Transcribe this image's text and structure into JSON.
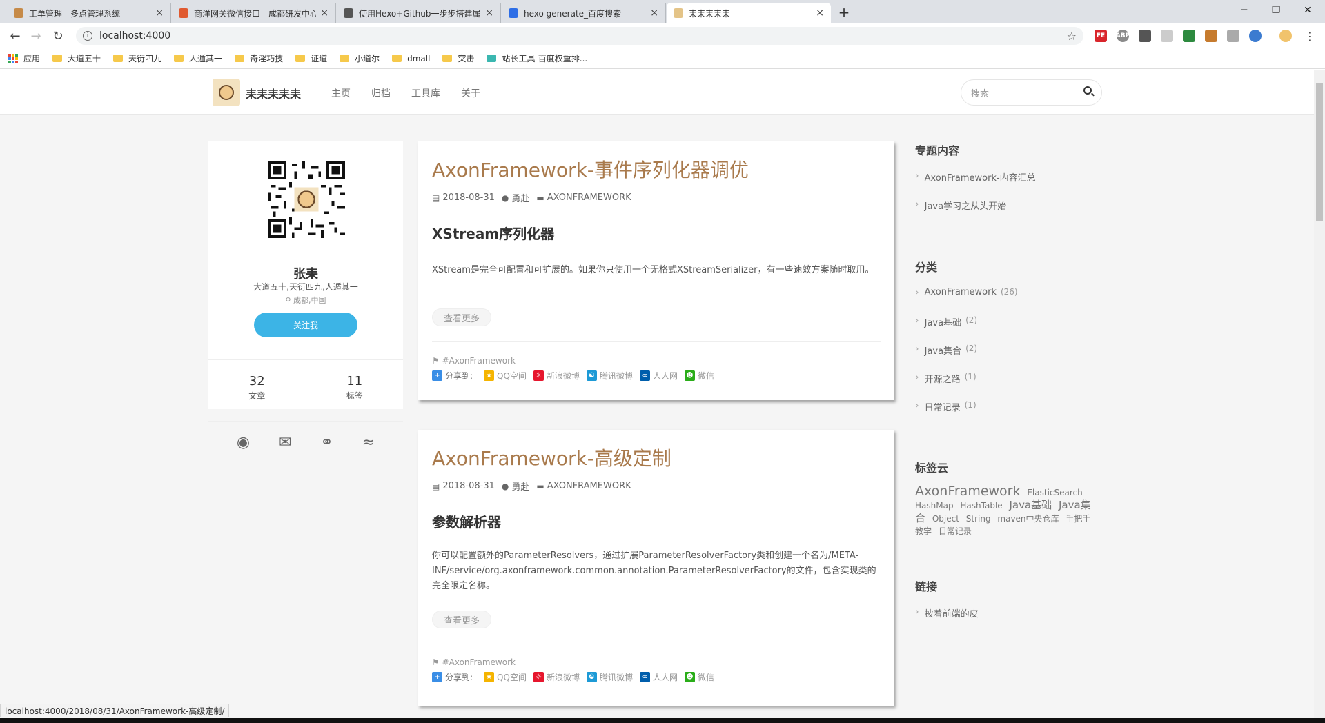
{
  "browser": {
    "tabs": [
      {
        "title": "工单管理 - 多点管理系统",
        "fav_color": "#c68a48"
      },
      {
        "title": "商洋网关微信接口 - 成都研发中心",
        "fav_color": "#e05a30"
      },
      {
        "title": "使用Hexo+Github一步步搭建属...",
        "fav_color": "#555555"
      },
      {
        "title": "hexo generate_百度搜索",
        "fav_color": "#2e6ee6"
      },
      {
        "title": "耒耒耒耒耒",
        "fav_color": "#e4c488"
      }
    ],
    "close_glyph": "×",
    "newtab_glyph": "+",
    "window": {
      "minimize": "─",
      "maximize": "❐",
      "close": "✕"
    },
    "url": "localhost:4000",
    "bookmarks": [
      "应用",
      "大道五十",
      "天衍四九",
      "人遁其一",
      "奇淫巧技",
      "证道",
      "小道尔",
      "dmall",
      "突击",
      "站长工具-百度权重排..."
    ],
    "extensions": [
      "FE",
      "ABP",
      "",
      "",
      "",
      "",
      "",
      "",
      ""
    ],
    "status_url": "localhost:4000/2018/08/31/AxonFramework-高级定制/"
  },
  "site": {
    "brand": "耒耒耒耒耒",
    "menu": [
      "主页",
      "归档",
      "工具库",
      "关于"
    ],
    "search_placeholder": "搜索"
  },
  "profile": {
    "name": "张耒",
    "motto": "大道五十,天衍四九,人遁其一",
    "location": "成都,中国",
    "follow_label": "关注我",
    "stats": [
      {
        "num": "32",
        "label": "文章"
      },
      {
        "num": "11",
        "label": "标签"
      }
    ],
    "social": [
      "github-icon",
      "mail-icon",
      "wechat-icon",
      "rss-icon"
    ]
  },
  "posts": [
    {
      "title": "AxonFramework-事件序列化器调优",
      "date": "2018-08-31",
      "author": "勇赴",
      "category": "AXONFRAMEWORK",
      "heading": "XStream序列化器",
      "excerpt": "XStream是完全可配置和可扩展的。如果你只使用一个无格式XStreamSerializer，有一些速效方案随时取用。",
      "more": "查看更多",
      "tag": "#AxonFramework"
    },
    {
      "title": "AxonFramework-高级定制",
      "date": "2018-08-31",
      "author": "勇赴",
      "category": "AXONFRAMEWORK",
      "heading": "参数解析器",
      "excerpt": "你可以配置额外的ParameterResolvers，通过扩展ParameterResolverFactory类和创建一个名为/META-INF/service/org.axonframework.common.annotation.ParameterResolverFactory的文件，包含实现类的完全限定名称。",
      "more": "查看更多",
      "tag": "#AxonFramework"
    }
  ],
  "share": {
    "label": "分享到:",
    "targets": [
      {
        "name": "QQ空间",
        "color": "#f5b400"
      },
      {
        "name": "新浪微博",
        "color": "#e6162d"
      },
      {
        "name": "腾讯微博",
        "color": "#1d9ad6"
      },
      {
        "name": "人人网",
        "color": "#005eac"
      },
      {
        "name": "微信",
        "color": "#2aad19"
      }
    ]
  },
  "sidebar": {
    "topics_title": "专题内容",
    "topics": [
      "AxonFramework-内容汇总",
      "Java学习之从头开始"
    ],
    "categories_title": "分类",
    "categories": [
      {
        "name": "AxonFramework",
        "count": "(26)"
      },
      {
        "name": "Java基础",
        "count": "(2)"
      },
      {
        "name": "Java集合",
        "count": "(2)"
      },
      {
        "name": "开源之路",
        "count": "(1)"
      },
      {
        "name": "日常记录",
        "count": "(1)"
      }
    ],
    "tagcloud_title": "标签云",
    "tags": [
      {
        "name": "AxonFramework",
        "size": "xl"
      },
      {
        "name": "ElasticSearch",
        "size": "sm"
      },
      {
        "name": "HashMap",
        "size": "sm"
      },
      {
        "name": "HashTable",
        "size": "sm"
      },
      {
        "name": "Java基础",
        "size": "lg"
      },
      {
        "name": "Java集合",
        "size": "lg"
      },
      {
        "name": "Object",
        "size": "sm"
      },
      {
        "name": "String",
        "size": "sm"
      },
      {
        "name": "maven中央仓库",
        "size": "sm"
      },
      {
        "name": "手把手教学",
        "size": "sm"
      },
      {
        "name": "日常记录",
        "size": "sm"
      }
    ],
    "links_title": "链接",
    "links": [
      "披着前端的皮"
    ]
  }
}
